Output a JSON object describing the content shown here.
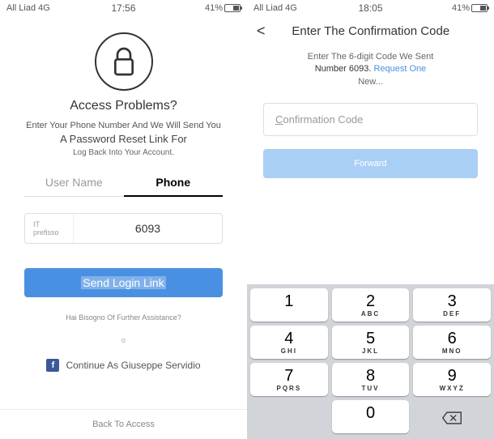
{
  "left": {
    "status": {
      "carrier": "All Liad 4G",
      "time": "17:56",
      "battery": "41%"
    },
    "title": "Access Problems?",
    "sub1": "Enter Your Phone Number And We Will Send You",
    "sub2": "A Password Reset Link For",
    "sub3": "Log Back Into Your Account.",
    "tabs": {
      "username": "User Name",
      "phone": "Phone"
    },
    "prefix": "IT prefisso",
    "phone_value": "6093",
    "btn_label": "Send Login Link",
    "help": "Hai Bisogno Of Further Assistance?",
    "divider": "o",
    "fb_label": "Continue As Giuseppe Servidio",
    "back": "Back To Access"
  },
  "right": {
    "status": {
      "carrier": "All Liad 4G",
      "time": "18:05",
      "battery": "41%"
    },
    "header": "Enter The Confirmation Code",
    "info_line1": "Enter The 6-digit Code We Sent",
    "info_num": "Number 6093.",
    "info_link": "Request One",
    "info_new": "New...",
    "placeholder": "Confirmation Code",
    "btn_label": "Forward",
    "keypad": [
      [
        {
          "d": "1",
          "l": ""
        },
        {
          "d": "2",
          "l": "ABC"
        },
        {
          "d": "3",
          "l": "DEF"
        }
      ],
      [
        {
          "d": "4",
          "l": "GHI"
        },
        {
          "d": "5",
          "l": "JKL"
        },
        {
          "d": "6",
          "l": "MNO"
        }
      ],
      [
        {
          "d": "7",
          "l": "PQRS"
        },
        {
          "d": "8",
          "l": "TUV"
        },
        {
          "d": "9",
          "l": "WXYZ"
        }
      ]
    ],
    "zero": "0"
  }
}
